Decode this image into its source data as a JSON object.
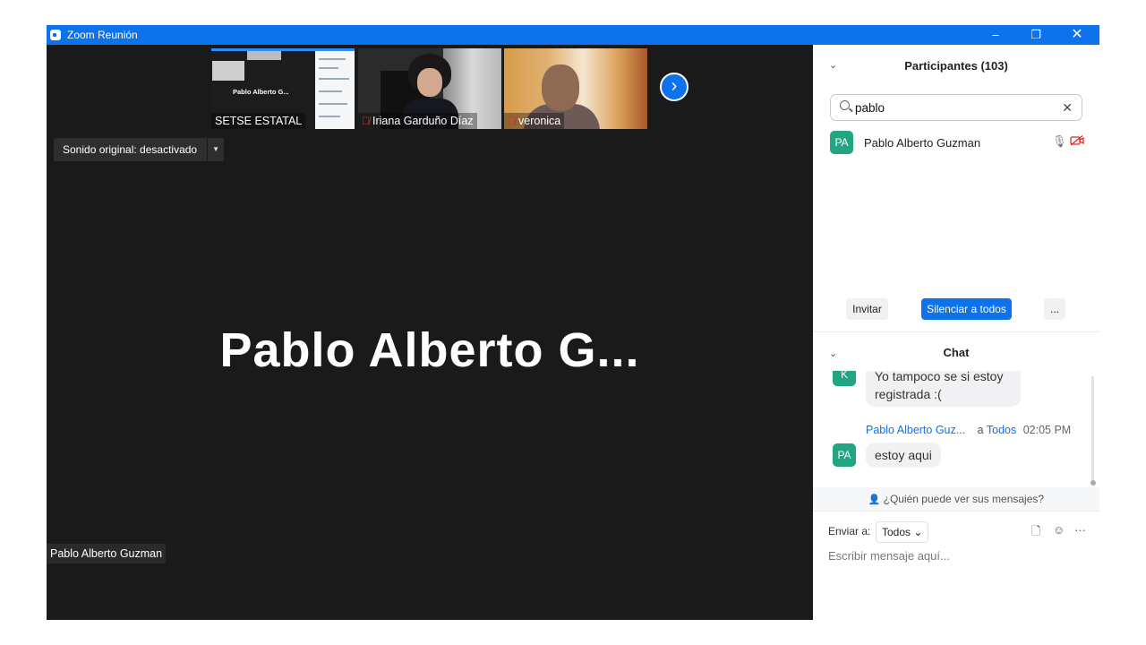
{
  "window": {
    "title": "Zoom Reunión",
    "controls": {
      "minimize": "–",
      "restore": "❐",
      "close": "✕"
    }
  },
  "thumbnails": [
    {
      "name": "SETSE ESTATAL",
      "inner_label": "Pablo Alberto G...",
      "muted": false
    },
    {
      "name": "Iriana Garduño Díaz",
      "muted": true
    },
    {
      "name": "veronica",
      "muted": true
    }
  ],
  "stage": {
    "original_sound": "Sonido original: desactivado",
    "speaker_big_name": "Pablo Alberto G...",
    "speaker_label": "Pablo Alberto Guzman",
    "next_icon": "›"
  },
  "participants": {
    "title": "Participantes (103)",
    "search_value": "pablo",
    "list": [
      {
        "initials": "PA",
        "name": "Pablo Alberto Guzman"
      }
    ],
    "buttons": {
      "invite": "Invitar",
      "mute_all": "Silenciar a todos",
      "more": "..."
    }
  },
  "chat": {
    "title": "Chat",
    "messages": [
      {
        "initials": "K",
        "text": "Yo tampoco se si estoy registrada :("
      },
      {
        "sender": "Pablo Alberto Guz...",
        "to_prefix": "a",
        "to": "Todos",
        "time": "02:05 PM",
        "initials": "PA",
        "text": "estoy aqui"
      }
    ],
    "who_can_see": "¿Quién puede ver sus mensajes?",
    "send_to_label": "Enviar a:",
    "send_to_value": "Todos",
    "placeholder": "Escribir mensaje aquí...",
    "more": "···"
  },
  "colors": {
    "accent": "#0e72ed",
    "avatar": "#23a583",
    "stage_bg": "#1a1a1a"
  }
}
